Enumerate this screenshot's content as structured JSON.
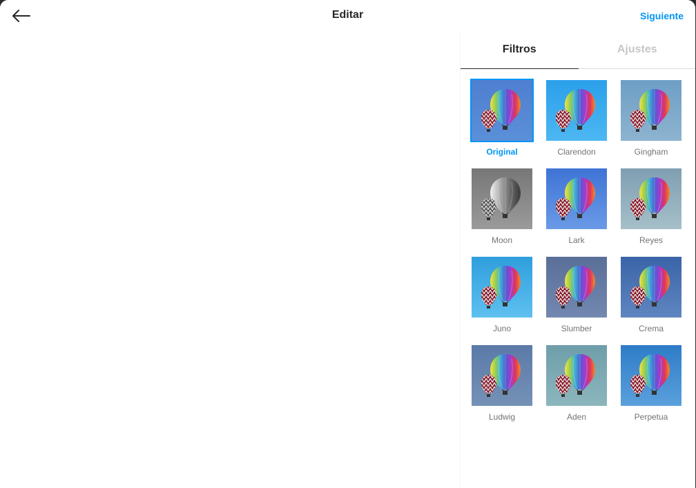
{
  "header": {
    "title": "Editar",
    "next_label": "Siguiente",
    "back_icon": "arrow-left-icon"
  },
  "tabs": [
    {
      "label": "Filtros",
      "active": true
    },
    {
      "label": "Ajustes",
      "active": false
    }
  ],
  "colors": {
    "accent": "#0095f6",
    "text": "#262626",
    "muted": "#737373"
  },
  "filters": [
    {
      "label": "Original",
      "selected": true,
      "bg": [
        "#4f7fd0",
        "#5b8fd8"
      ],
      "gray": false
    },
    {
      "label": "Clarendon",
      "selected": false,
      "bg": [
        "#2aa0ea",
        "#4db7f2"
      ],
      "gray": false
    },
    {
      "label": "Gingham",
      "selected": false,
      "bg": [
        "#6e9fc6",
        "#8db3cf"
      ],
      "gray": false
    },
    {
      "label": "Moon",
      "selected": false,
      "bg": [
        "#777777",
        "#9a9a9a"
      ],
      "gray": true
    },
    {
      "label": "Lark",
      "selected": false,
      "bg": [
        "#3f74d6",
        "#6a9ae6"
      ],
      "gray": false
    },
    {
      "label": "Reyes",
      "selected": false,
      "bg": [
        "#7f9fb2",
        "#a6bfc9"
      ],
      "gray": false
    },
    {
      "label": "Juno",
      "selected": false,
      "bg": [
        "#2f9edd",
        "#5ec0ef"
      ],
      "gray": false
    },
    {
      "label": "Slumber",
      "selected": false,
      "bg": [
        "#5a6f98",
        "#7388b0"
      ],
      "gray": false
    },
    {
      "label": "Crema",
      "selected": false,
      "bg": [
        "#3a64a8",
        "#5f86c0"
      ],
      "gray": false
    },
    {
      "label": "Ludwig",
      "selected": false,
      "bg": [
        "#5b7aa8",
        "#7591b6"
      ],
      "gray": false
    },
    {
      "label": "Aden",
      "selected": false,
      "bg": [
        "#6e9eaa",
        "#8cb6bd"
      ],
      "gray": false
    },
    {
      "label": "Perpetua",
      "selected": false,
      "bg": [
        "#2e7cc8",
        "#5aa0dc"
      ],
      "gray": false
    }
  ]
}
